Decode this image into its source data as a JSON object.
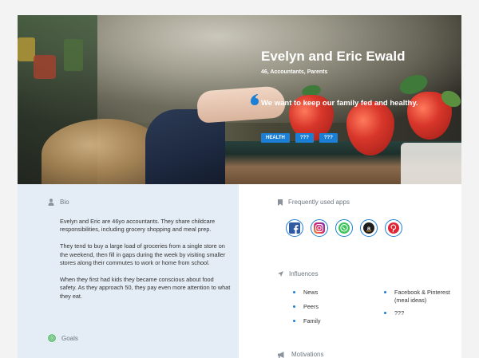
{
  "hero": {
    "title": "Evelyn and Eric Ewald",
    "subtitle": "46, Accountants, Parents",
    "quote": "We want to keep our family fed and healthy.",
    "tags": [
      "HEALTH",
      "???",
      "???"
    ],
    "tag_color": "#1c7fd6"
  },
  "bio": {
    "heading": "Bio",
    "icon": "person-icon",
    "paragraphs": [
      "Evelyn and Eric are 46yo accountants. They share childcare responsibilities, including grocery shopping and meal prep.",
      "They tend to buy a large load of groceries from a single store on the weekend, then fill in gaps during the week by visiting smaller stores along their commutes to work or home from school.",
      "When they first had kids they became conscious about food safety. As they approach 50, they pay even more attention to what they eat."
    ]
  },
  "goals": {
    "heading": "Goals",
    "icon": "target-icon"
  },
  "apps": {
    "heading": "Frequently used apps",
    "icon": "bookmark-icon",
    "items": [
      "facebook-icon",
      "instagram-icon",
      "whatsapp-icon",
      "amazon-icon",
      "pinterest-icon"
    ]
  },
  "influences": {
    "heading": "Influences",
    "icon": "navigation-arrow-icon",
    "left": [
      "News",
      "Peers",
      "Family"
    ],
    "right": [
      "Facebook & Pinterest (meal ideas)",
      "???"
    ]
  },
  "motivations": {
    "heading": "Motivations",
    "icon": "megaphone-icon"
  },
  "colors": {
    "left_panel": "#e4edf5",
    "accent": "#1c7fd6"
  }
}
